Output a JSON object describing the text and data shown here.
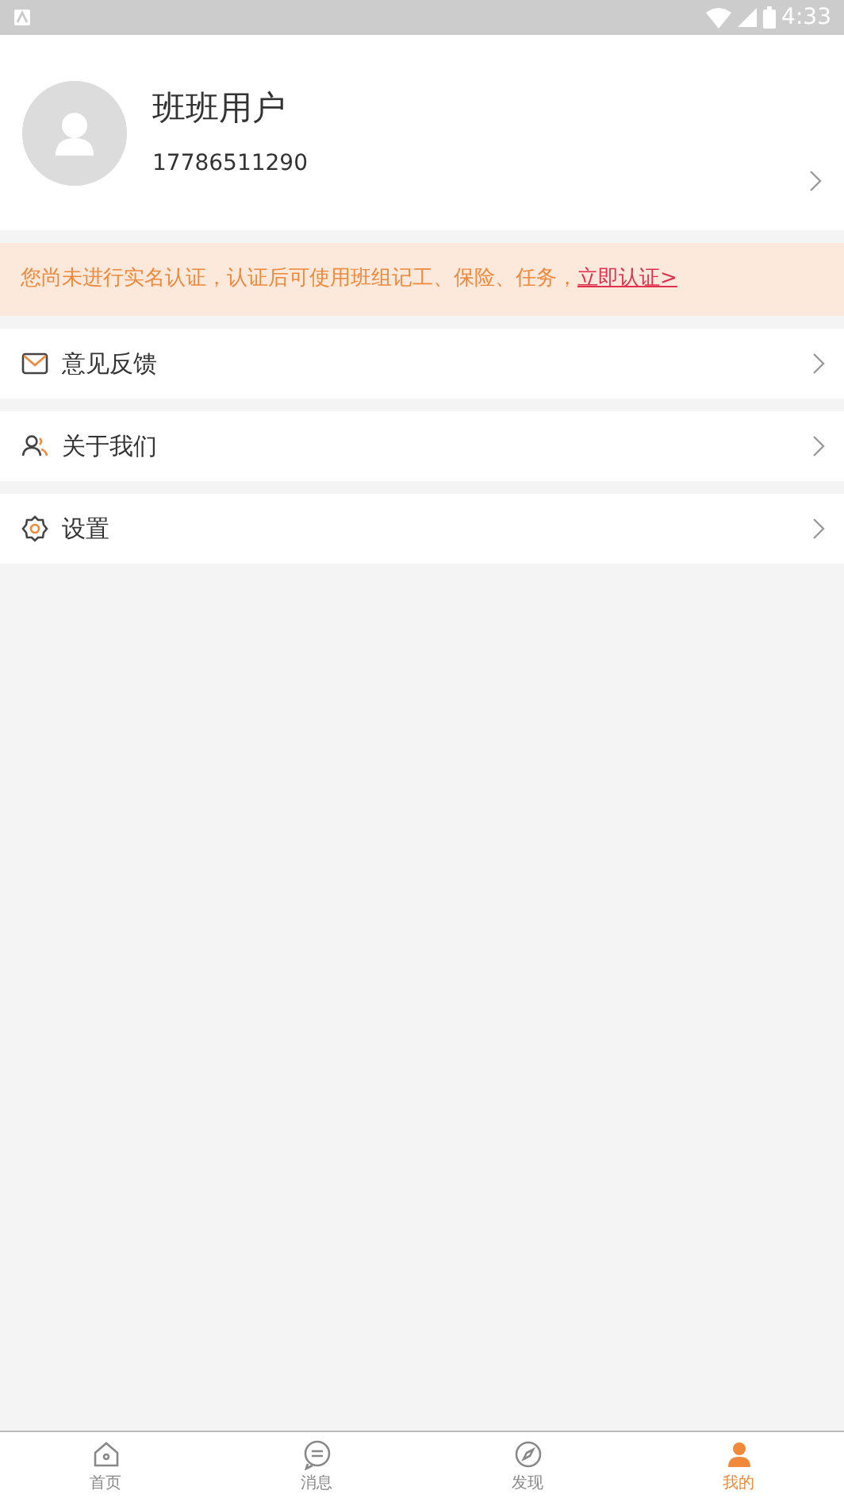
{
  "status_bar": {
    "time": "4:33"
  },
  "profile": {
    "name": "班班用户",
    "phone": "17786511290"
  },
  "notice": {
    "text": "您尚未进行实名认证，认证后可使用班组记工、保险、任务，",
    "link": "立即认证>"
  },
  "menu": [
    {
      "kind": "mail",
      "label": "意见反馈"
    },
    {
      "kind": "people",
      "label": "关于我们"
    },
    {
      "kind": "gear",
      "label": "设置"
    }
  ],
  "tabbar": [
    {
      "kind": "home",
      "label": "首页",
      "selected": false
    },
    {
      "kind": "chat",
      "label": "消息",
      "selected": false
    },
    {
      "kind": "discover",
      "label": "发现",
      "selected": false
    },
    {
      "kind": "person",
      "label": "我的",
      "selected": true
    }
  ]
}
